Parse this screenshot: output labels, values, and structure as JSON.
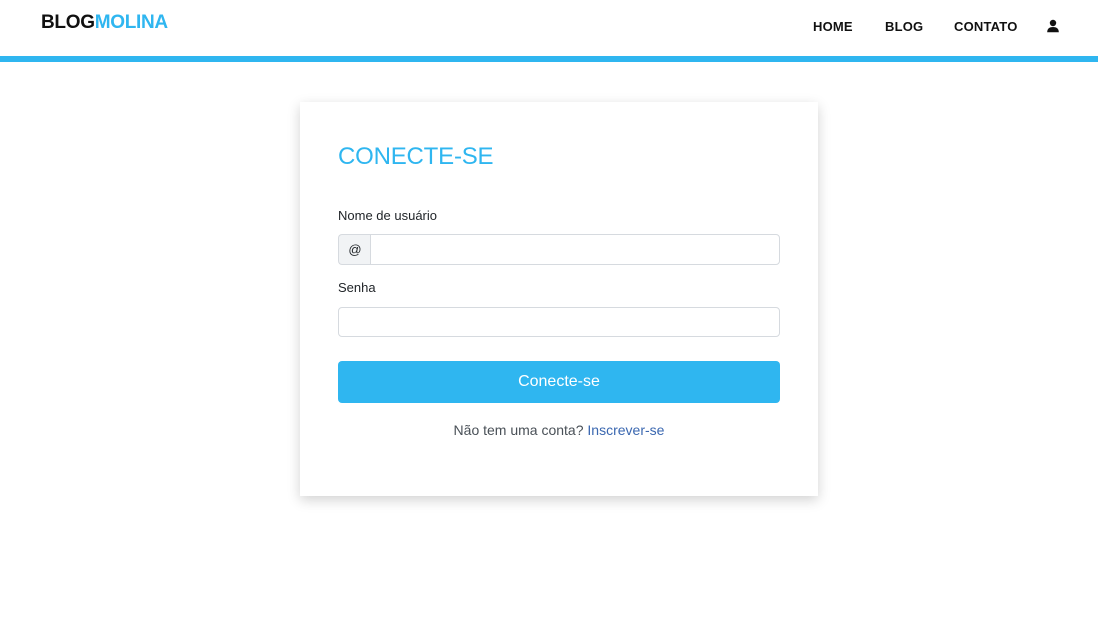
{
  "colors": {
    "accent": "#2fb6f0",
    "link": "#3a67b0"
  },
  "navbar": {
    "brand_part1": "BLOG",
    "brand_part2": "MOLINA",
    "links": [
      "HOME",
      "BLOG",
      "CONTATO"
    ],
    "user_icon": "user-icon"
  },
  "login": {
    "title": "CONECTE-SE",
    "username_label": "Nome de usuário",
    "username_prefix": "@",
    "username_value": "",
    "password_label": "Senha",
    "password_value": "",
    "submit_label": "Conecte-se",
    "signup_text": "Não tem uma conta?",
    "signup_link": "Inscrever-se"
  }
}
